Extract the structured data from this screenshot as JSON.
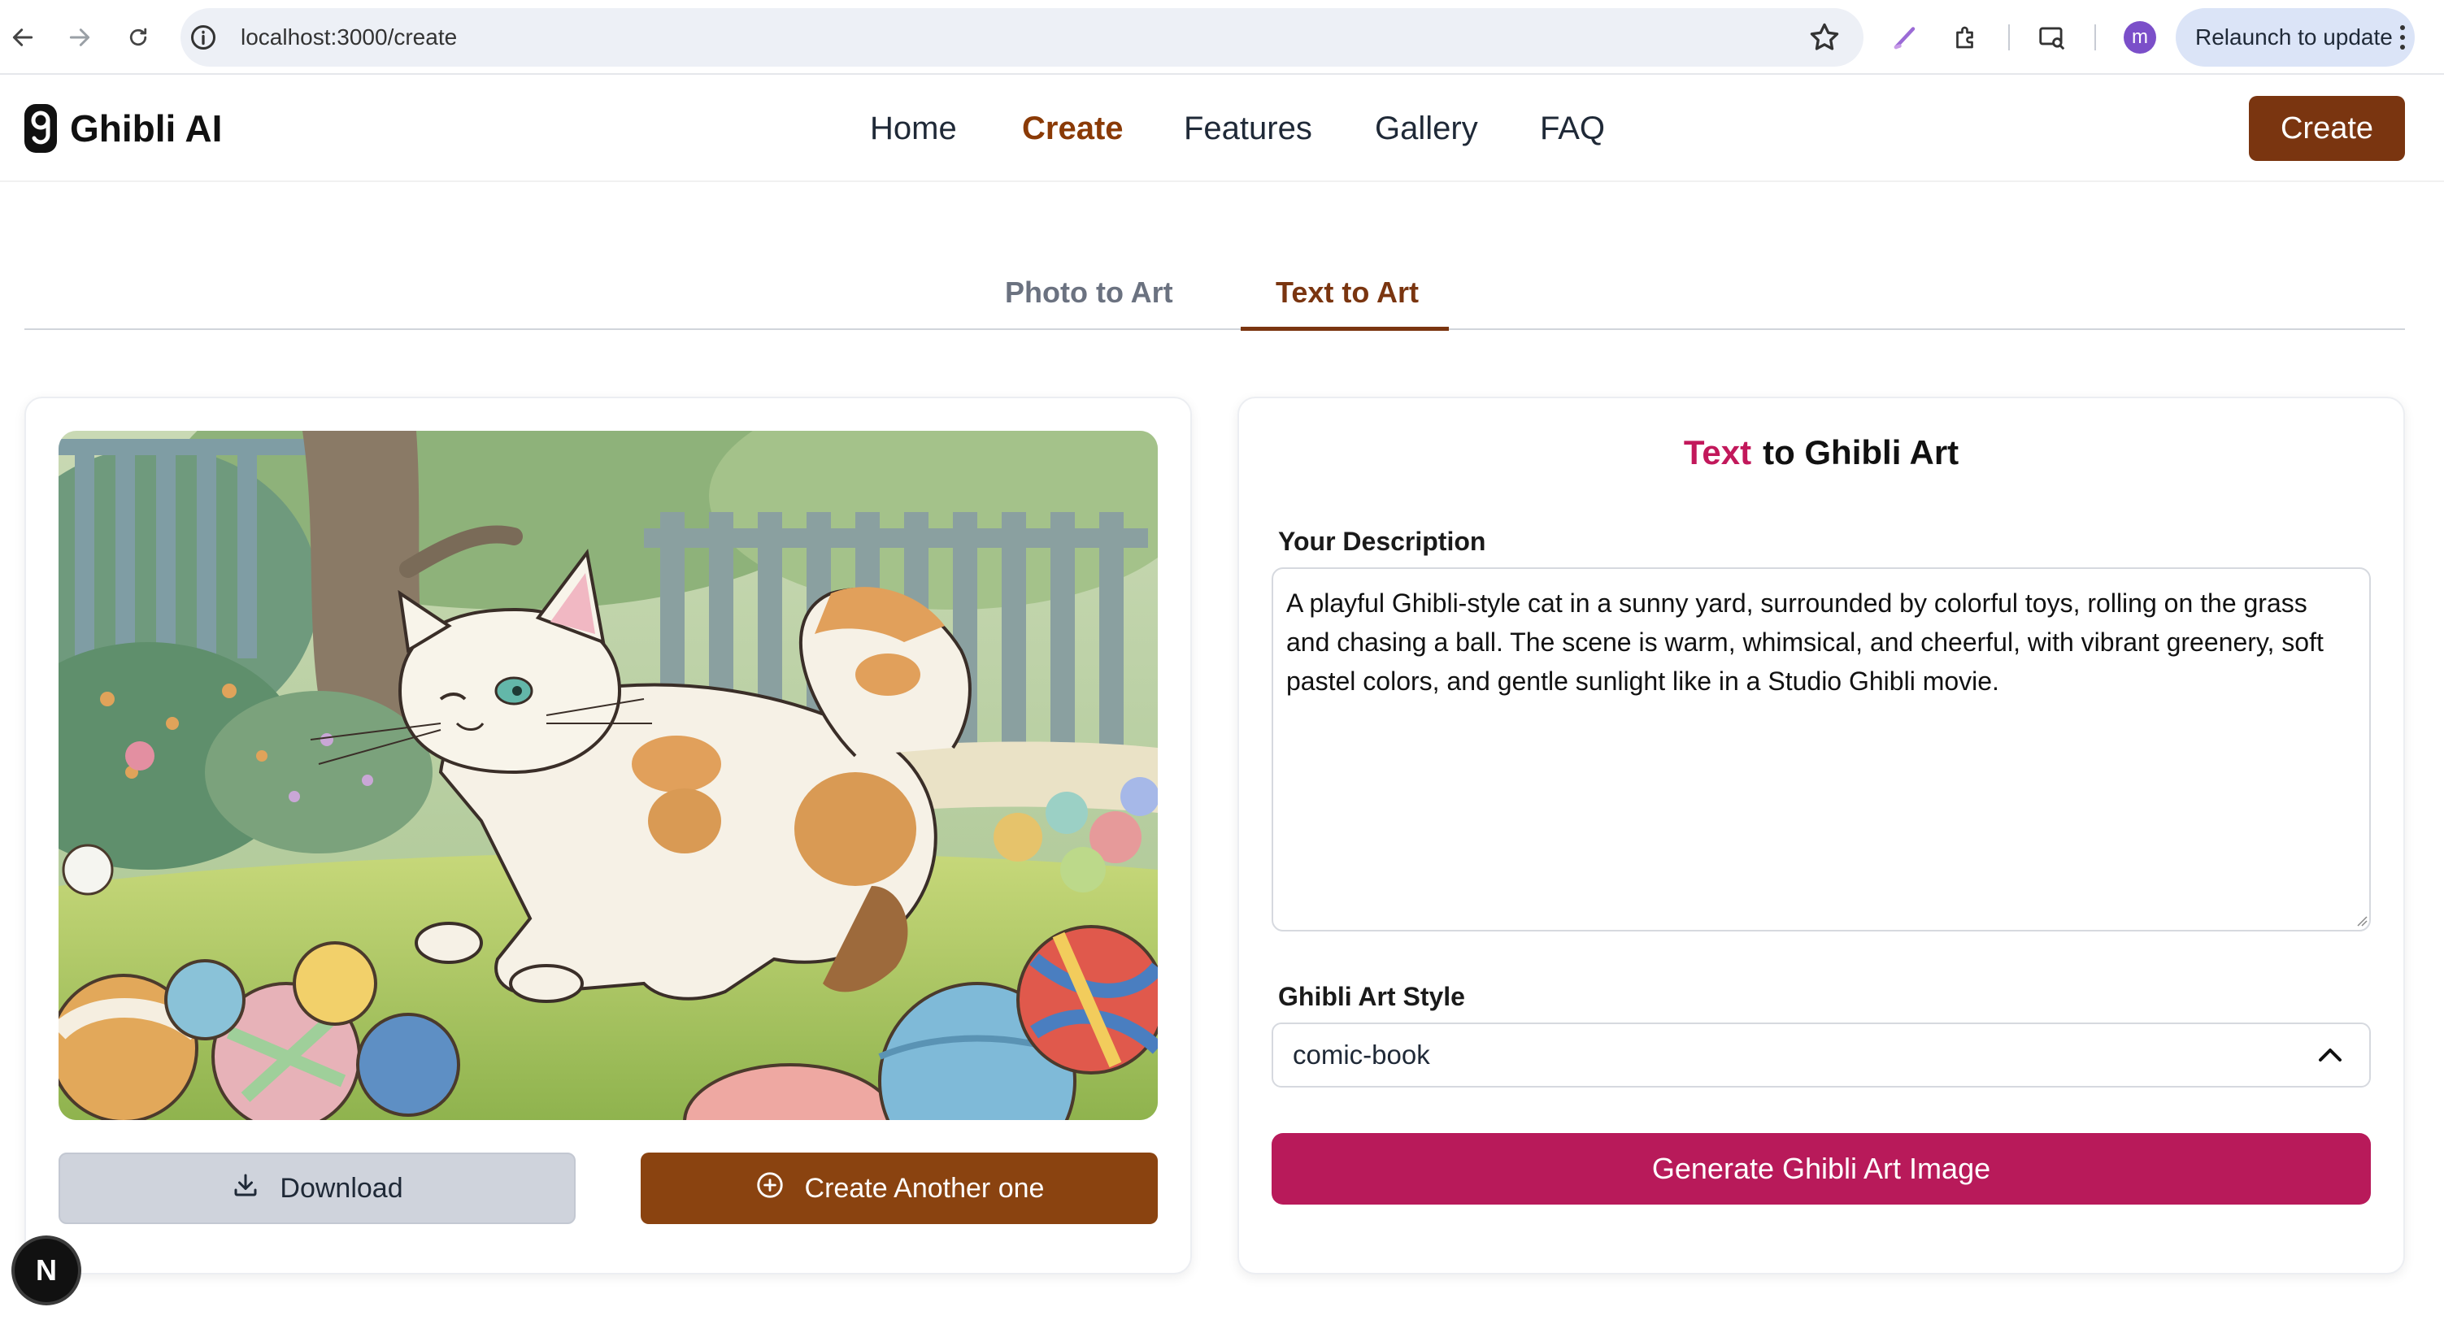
{
  "browser": {
    "url": "localhost:3000/create",
    "profile_initial": "m",
    "relaunch_label": "Relaunch to update"
  },
  "site": {
    "logo_text": "Ghibli AI",
    "nav": [
      "Home",
      "Create",
      "Features",
      "Gallery",
      "FAQ"
    ],
    "active_nav": "Create",
    "header_button": "Create"
  },
  "tabs": {
    "items": [
      "Photo to Art",
      "Text to Art"
    ],
    "active": "Text to Art"
  },
  "result": {
    "image_alt": "Ghibli-style cat playing in a sunny yard with colorful balls",
    "download_label": "Download",
    "create_another_label": "Create Another one"
  },
  "form": {
    "title_accent": "Text",
    "title_rest": "to Ghibli Art",
    "description_label": "Your Description",
    "description_value": "A playful Ghibli-style cat in a sunny yard, surrounded by colorful toys, rolling on the grass and chasing a ball. The scene is warm, whimsical, and cheerful, with vibrant greenery, soft pastel colors, and gentle sunlight like in a Studio Ghibli movie.",
    "style_label": "Ghibli Art Style",
    "style_value": "comic-book",
    "generate_label": "Generate Ghibli Art Image"
  },
  "dev_badge": "N",
  "colors": {
    "brand_brown": "#7a3510",
    "accent_pink": "#c2185b",
    "generate_bg": "#b81a5a"
  }
}
